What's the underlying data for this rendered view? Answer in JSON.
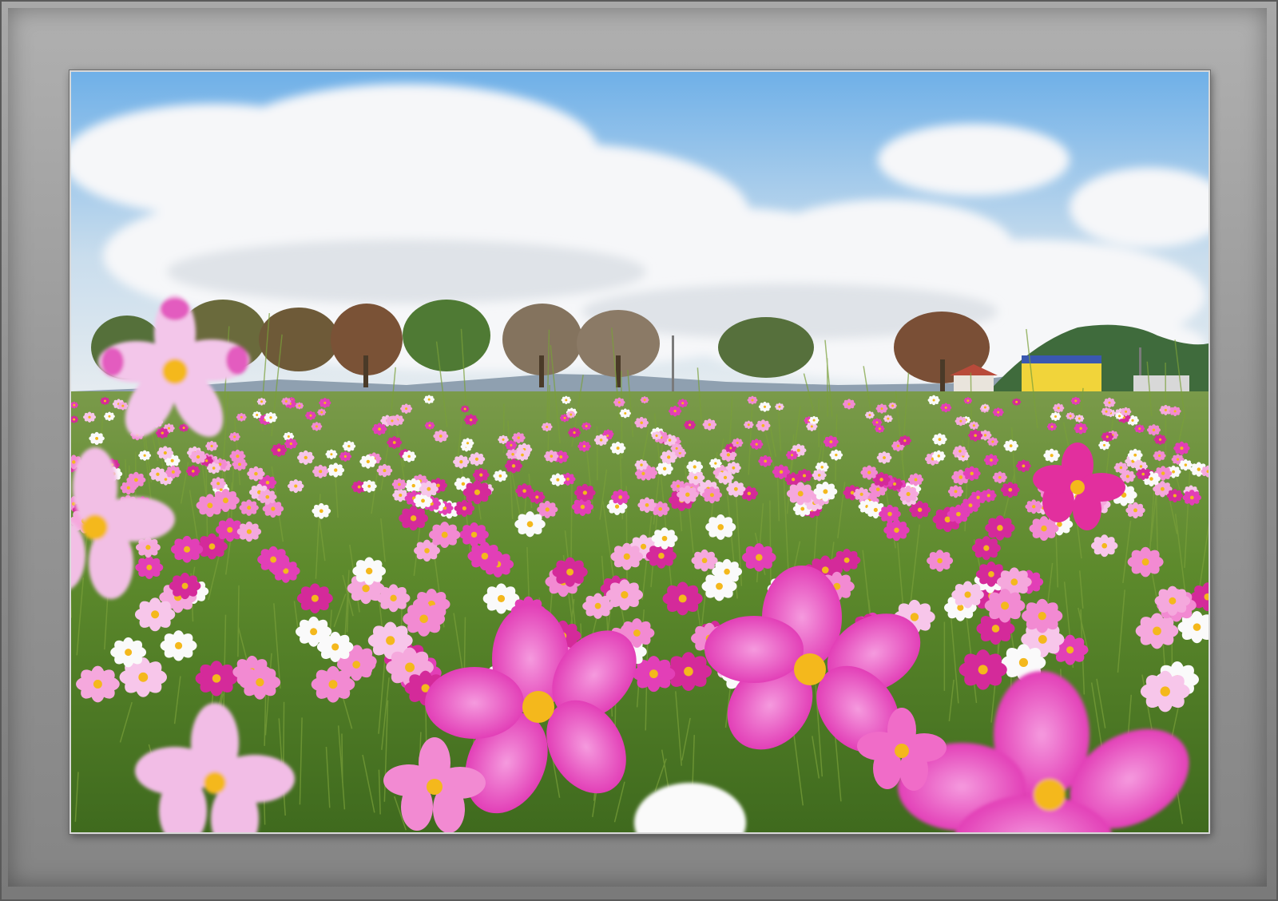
{
  "image": {
    "description_alt": "",
    "palette": {
      "sky_top": "#7fb6e6",
      "sky_bottom": "#e6edf2",
      "cloud": "#f6f7f9",
      "hill": "#3f6b3c",
      "tree_foliage": "#5b6e3a",
      "tree_autumn": "#8a5a3a",
      "meadow": "#5f8a2e",
      "cosmos_magenta": "#e23fb7",
      "cosmos_pink": "#f28ad2",
      "cosmos_white": "#fafafa",
      "flower_center": "#f4b81c",
      "building": "#f1d43a",
      "frame": "#9a9a9a"
    }
  }
}
